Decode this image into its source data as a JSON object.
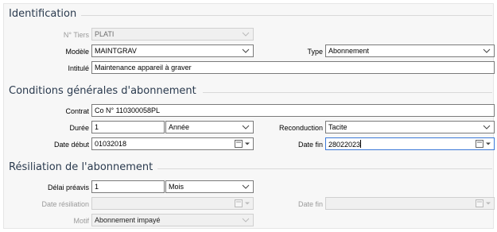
{
  "identification": {
    "title": "Identification",
    "tiers": {
      "label": "N° Tiers",
      "value": "PLATI"
    },
    "modele": {
      "label": "Modèle",
      "value": "MAINTGRAV"
    },
    "type": {
      "label": "Type",
      "value": "Abonnement"
    },
    "intitule": {
      "label": "Intitulé",
      "value": "Maintenance appareil à graver"
    }
  },
  "conditions": {
    "title": "Conditions générales d'abonnement",
    "contrat": {
      "label": "Contrat",
      "value": "Co N° 110300058PL"
    },
    "duree": {
      "label": "Durée",
      "value": "1",
      "unit": "Année"
    },
    "reconduction": {
      "label": "Reconduction",
      "value": "Tacite"
    },
    "date_debut": {
      "label": "Date début",
      "value": "01032018"
    },
    "date_fin": {
      "label": "Date fin",
      "value": "28022023"
    }
  },
  "resiliation": {
    "title": "Résiliation de l'abonnement",
    "delai": {
      "label": "Délai préavis",
      "value": "1",
      "unit": "Mois"
    },
    "date_resiliation": {
      "label": "Date résiliation",
      "value": ""
    },
    "date_fin": {
      "label": "Date fin",
      "value": ""
    },
    "motif": {
      "label": "Motif",
      "value": "Abonnement impayé"
    }
  }
}
